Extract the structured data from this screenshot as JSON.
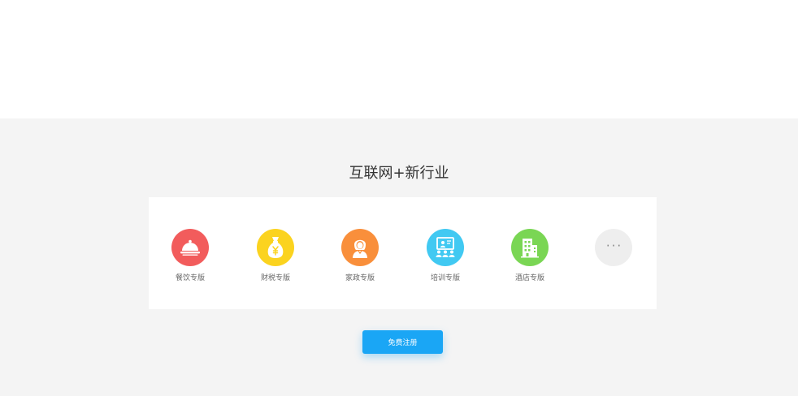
{
  "section": {
    "title": "互联网+新行业"
  },
  "industries": [
    {
      "label": "餐饮专版",
      "icon": "dining-cloche-icon",
      "color": "#f25c5c"
    },
    {
      "label": "财税专版",
      "icon": "money-bag-icon",
      "color": "#fbd31f"
    },
    {
      "label": "家政专版",
      "icon": "housekeeper-icon",
      "color": "#f98f3b"
    },
    {
      "label": "培训专版",
      "icon": "training-board-icon",
      "color": "#41c9f2"
    },
    {
      "label": "酒店专版",
      "icon": "hotel-building-icon",
      "color": "#7ad654"
    }
  ],
  "more": {
    "icon": "more-dots-icon",
    "glyph": "···",
    "color": "#eeeeee"
  },
  "register_button": {
    "label": "免费注册",
    "color": "#1aa6f5"
  }
}
